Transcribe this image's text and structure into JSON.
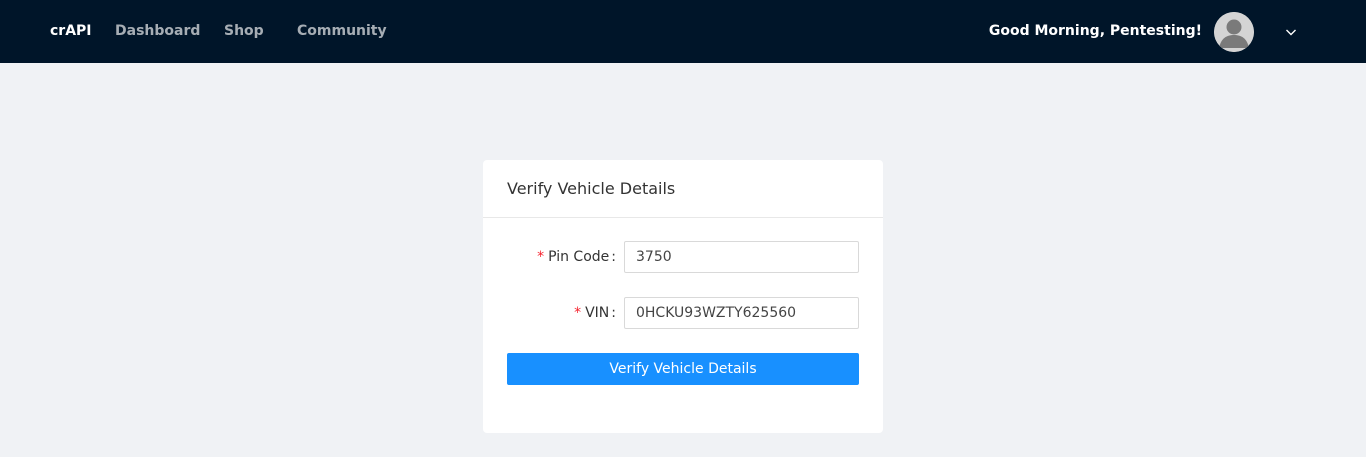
{
  "header": {
    "brand": "crAPI",
    "nav": [
      "Dashboard",
      "Shop",
      "Community"
    ],
    "greeting": "Good Morning, Pentesting!",
    "avatar_icon": "user-avatar-icon",
    "dropdown_icon": "chevron-down-icon"
  },
  "form": {
    "title": "Verify Vehicle Details",
    "pin_label": "Pin Code",
    "pin_value": "3750",
    "vin_label": "VIN",
    "vin_value": "0HCKU93WZTY625560",
    "required_mark": "*",
    "colon": ":",
    "submit_label": "Verify Vehicle Details"
  },
  "colors": {
    "header_bg": "#001529",
    "page_bg": "#f0f2f5",
    "primary": "#1890ff",
    "required": "#f5222d"
  }
}
